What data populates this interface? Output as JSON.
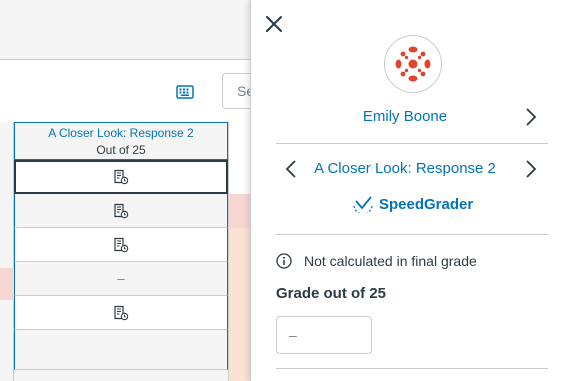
{
  "gradebook": {
    "search_placeholder": "Se",
    "column": {
      "title": "A Closer Look: Response 2",
      "subtitle": "Out of 25"
    },
    "rows": [
      {
        "value": "",
        "icon": "submission-pending-icon"
      },
      {
        "value": "",
        "icon": "submission-pending-icon"
      },
      {
        "value": "",
        "icon": "submission-pending-icon"
      },
      {
        "value": "–",
        "icon": ""
      },
      {
        "value": "",
        "icon": "submission-pending-icon"
      },
      {
        "value": "",
        "icon": ""
      }
    ],
    "colors": {
      "accent": "#0374b5",
      "late_pink": "#f8d7d3",
      "missing_orange": "#fbe3d3"
    }
  },
  "tray": {
    "close_icon": "close-icon",
    "student_name": "Emily Boone",
    "assignment_name": "A Closer Look: Response 2",
    "speedgrader_label": "SpeedGrader",
    "note": "Not calculated in final grade",
    "grade_label": "Grade out of 25",
    "grade_value": "–",
    "avatar_color": "#e0442f"
  }
}
